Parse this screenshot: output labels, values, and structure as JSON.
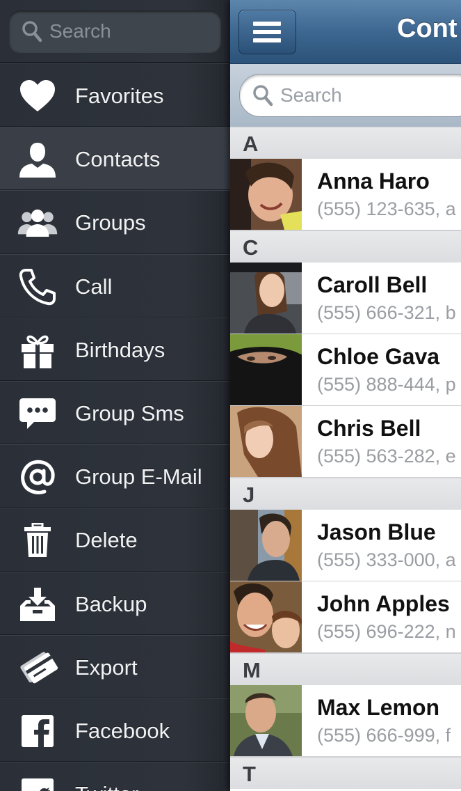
{
  "sidebar": {
    "search_placeholder": "Search",
    "items": [
      {
        "label": "Favorites",
        "icon": "heart-icon",
        "active": false
      },
      {
        "label": "Contacts",
        "icon": "person-icon",
        "active": true
      },
      {
        "label": "Groups",
        "icon": "group-icon",
        "active": false
      },
      {
        "label": "Call",
        "icon": "phone-icon",
        "active": false
      },
      {
        "label": "Birthdays",
        "icon": "gift-icon",
        "active": false
      },
      {
        "label": "Group Sms",
        "icon": "chat-bubble-icon",
        "active": false
      },
      {
        "label": "Group E-Mail",
        "icon": "at-icon",
        "active": false
      },
      {
        "label": "Delete",
        "icon": "trash-icon",
        "active": false
      },
      {
        "label": "Backup",
        "icon": "backup-icon",
        "active": false
      },
      {
        "label": "Export",
        "icon": "cards-icon",
        "active": false
      },
      {
        "label": "Facebook",
        "icon": "facebook-icon",
        "active": false
      },
      {
        "label": "Twitter",
        "icon": "twitter-icon",
        "active": false
      }
    ]
  },
  "navbar": {
    "title": "Cont",
    "menu_icon": "hamburger-icon"
  },
  "search": {
    "placeholder": "Search"
  },
  "contacts": {
    "sections": [
      {
        "letter": "A",
        "rows": [
          {
            "name": "Anna Haro",
            "detail": "(555) 123-635, a"
          }
        ]
      },
      {
        "letter": "C",
        "rows": [
          {
            "name": "Caroll Bell",
            "detail": "(555) 666-321, b"
          },
          {
            "name": "Chloe Gava",
            "detail": "(555) 888-444, p"
          },
          {
            "name": "Chris Bell",
            "detail": "(555) 563-282, e"
          }
        ]
      },
      {
        "letter": "J",
        "rows": [
          {
            "name": "Jason Blue",
            "detail": "(555) 333-000, a"
          },
          {
            "name": "John Apples",
            "detail": "(555) 696-222, n"
          }
        ]
      },
      {
        "letter": "M",
        "rows": [
          {
            "name": "Max Lemon",
            "detail": "(555) 666-999, f"
          }
        ]
      },
      {
        "letter": "T",
        "rows": []
      }
    ]
  },
  "colors": {
    "sidebar_bg": "#2e333b",
    "navbar_blue": "#3d6790",
    "section_header": "#e2e3e5"
  }
}
